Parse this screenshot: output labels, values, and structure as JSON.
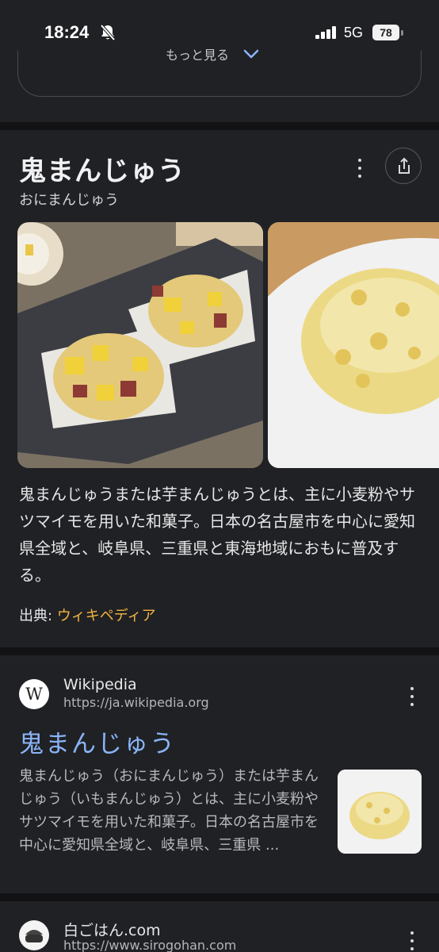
{
  "status_bar": {
    "time": "18:24",
    "network": "5G",
    "battery": "78"
  },
  "more_button": {
    "label": "もっと見る"
  },
  "knowledge_panel": {
    "title": "鬼まんじゅう",
    "reading": "おにまんじゅう",
    "description": "鬼まんじゅうまたは芋まんじゅうとは、主に小麦粉やサツマイモを用いた和菓子。日本の名古屋市を中心に愛知県全域と、岐阜県、三重県と東海地域におもに普及する。",
    "source_label": "出典:",
    "source_link": "ウィキペディア",
    "link_color": "#f2b440"
  },
  "results": [
    {
      "favicon": "W",
      "site_name": "Wikipedia",
      "url": "https://ja.wikipedia.org",
      "title": "鬼まんじゅう",
      "snippet": "鬼まんじゅう（おにまんじゅう）または芋まんじゅう（いもまんじゅう）とは、主に小麦粉やサツマイモを用いた和菓子。日本の名古屋市を中心に愛知県全域と、岐阜県、三重県 ...",
      "title_color": "#8ab4f8"
    },
    {
      "favicon": "rice-bowl-icon",
      "site_name": "白ごはん.com",
      "url": "https://www.sirogohan.com"
    }
  ]
}
